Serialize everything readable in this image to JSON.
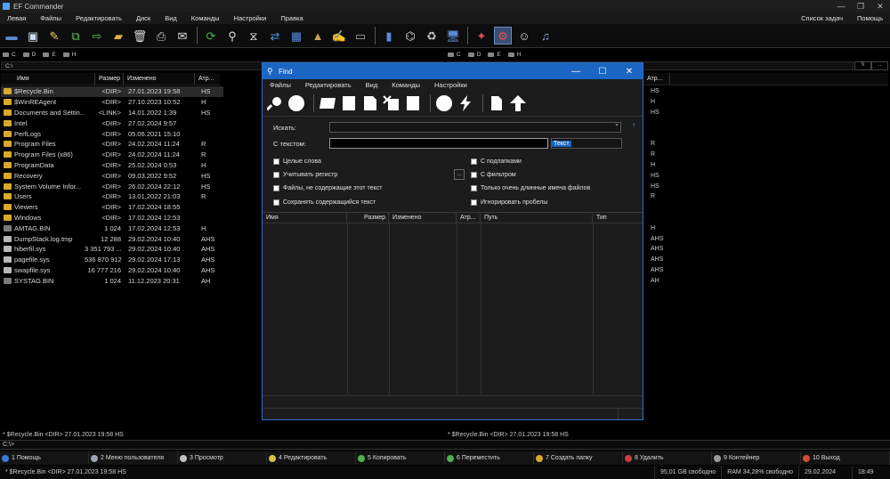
{
  "window": {
    "title": "EF Commander"
  },
  "menu": {
    "left": [
      "Левая",
      "Файлы",
      "Редактировать",
      "Диск",
      "Вид",
      "Команды",
      "Настройки",
      "Правка"
    ],
    "right": [
      "Список задач",
      "Помощь"
    ]
  },
  "drives": {
    "left": [
      "C",
      "D",
      "E",
      "H"
    ],
    "right": [
      "C",
      "D",
      "E",
      "H"
    ]
  },
  "left_path": "C:\\",
  "columns": {
    "name": "Имя",
    "size": "Размер",
    "modified": "Изменено",
    "attr": "Атр..."
  },
  "right_header": {
    "attr": "Атр..."
  },
  "files": [
    {
      "name": "$Recycle.Bin",
      "size": "<DIR>",
      "date": "27.01.2023",
      "time": "19:58",
      "attr": "HS",
      "kind": "folder",
      "selected": true
    },
    {
      "name": "$WinREAgent",
      "size": "<DIR>",
      "date": "27.10.2023",
      "time": "10:52",
      "attr": "H",
      "kind": "folder"
    },
    {
      "name": "Documents and Settin...",
      "size": "<LINK>",
      "date": "14.01.2022",
      "time": "1:39",
      "attr": "HS",
      "kind": "folder"
    },
    {
      "name": "Intel",
      "size": "<DIR>",
      "date": "27.02.2024",
      "time": "9:57",
      "attr": "",
      "kind": "folder"
    },
    {
      "name": "PerfLogs",
      "size": "<DIR>",
      "date": "05.06.2021",
      "time": "15:10",
      "attr": "",
      "kind": "folder"
    },
    {
      "name": "Program Files",
      "size": "<DIR>",
      "date": "24.02.2024",
      "time": "11:24",
      "attr": "R",
      "kind": "folder"
    },
    {
      "name": "Program Files (x86)",
      "size": "<DIR>",
      "date": "24.02.2024",
      "time": "11:24",
      "attr": "R",
      "kind": "folder"
    },
    {
      "name": "ProgramData",
      "size": "<DIR>",
      "date": "25.02.2024",
      "time": "0:53",
      "attr": "H",
      "kind": "folder"
    },
    {
      "name": "Recovery",
      "size": "<DIR>",
      "date": "09.03.2022",
      "time": "9:52",
      "attr": "HS",
      "kind": "folder"
    },
    {
      "name": "System Volume Infor...",
      "size": "<DIR>",
      "date": "26.02.2024",
      "time": "22:12",
      "attr": "HS",
      "kind": "folder"
    },
    {
      "name": "Users",
      "size": "<DIR>",
      "date": "13.01.2022",
      "time": "21:03",
      "attr": "R",
      "kind": "folder"
    },
    {
      "name": "Viewers",
      "size": "<DIR>",
      "date": "17.02.2024",
      "time": "18:55",
      "attr": "",
      "kind": "folder"
    },
    {
      "name": "Windows",
      "size": "<DIR>",
      "date": "17.02.2024",
      "time": "12:53",
      "attr": "",
      "kind": "folder"
    },
    {
      "name": "AMTAG.BIN",
      "size": "1 024",
      "date": "17.02.2024",
      "time": "12:53",
      "attr": "H",
      "kind": "sys"
    },
    {
      "name": "DumpStack.log.tmp",
      "size": "12 288",
      "date": "29.02.2024",
      "time": "10:40",
      "attr": "AHS",
      "kind": "file"
    },
    {
      "name": "hiberfil.sys",
      "size": "3 351 793 ...",
      "date": "29.02.2024",
      "time": "10:40",
      "attr": "AHS",
      "kind": "file"
    },
    {
      "name": "pagefile.sys",
      "size": "536 870 912",
      "date": "29.02.2024",
      "time": "17:13",
      "attr": "AHS",
      "kind": "file"
    },
    {
      "name": "swapfile.sys",
      "size": "16 777 216",
      "date": "29.02.2024",
      "time": "10:40",
      "attr": "AHS",
      "kind": "file"
    },
    {
      "name": "SYSTAG.BIN",
      "size": "1 024",
      "date": "11.12.2023",
      "time": "20:31",
      "attr": "AH",
      "kind": "sys"
    }
  ],
  "right_attrs": [
    "HS",
    "H",
    "HS",
    "",
    "",
    "R",
    "R",
    "H",
    "HS",
    "HS",
    "R",
    "",
    "",
    "H",
    "AHS",
    "AHS",
    "AHS",
    "AHS",
    "AH"
  ],
  "status_left": "* $Recycle.Bin   <DIR>  27.01.2023  19:58  HS",
  "status_right": "* $Recycle.Bin   <DIR>  27.01.2023  19:58  HS",
  "cmdline": "C:\\>",
  "fkeys": [
    {
      "label": "1 Помощь",
      "color": "#3d7bd6"
    },
    {
      "label": "2 Меню пользователя",
      "color": "#9aa4b0"
    },
    {
      "label": "3 Просмотр",
      "color": "#c0c0c0"
    },
    {
      "label": "4 Редактировать",
      "color": "#d8c04a"
    },
    {
      "label": "5 Копировать",
      "color": "#4fb04f"
    },
    {
      "label": "6 Переместить",
      "color": "#4fb04f"
    },
    {
      "label": "7 Создать папку",
      "color": "#d9a92c"
    },
    {
      "label": "8 Удалить",
      "color": "#c94040"
    },
    {
      "label": "9 Контейнер",
      "color": "#9a9a9a"
    },
    {
      "label": "10 Выход",
      "color": "#d04a3a"
    }
  ],
  "bottom": {
    "info": "* $Recycle.Bin   <DIR>  27.01.2023  19:58  HS",
    "free": "95,01 GB свободно",
    "ram": "RAM 34,28% свободно",
    "date": "29.02.2024",
    "time": "18:49"
  },
  "find": {
    "title": "Find",
    "menu": [
      "Файлы",
      "Редактировать",
      "Вид",
      "Команды",
      "Настройки"
    ],
    "search_label": "Искать:",
    "search_value": "",
    "text_label": "С текстом:",
    "text_value": "",
    "text_mode": "Текст",
    "checks_left": [
      "Целые слова",
      "Учитывать регистр",
      "Файлы, не содержащие этот текст",
      "Сохранять содержащийся текст"
    ],
    "checks_right": [
      "С подпапками",
      "С фильтром",
      "Только очень длинные имена файлов",
      "Игнорировать пробелы"
    ],
    "ellipsis": "...",
    "columns": [
      "Имя",
      "Размер",
      "Изменено",
      "Атр...",
      "Путь",
      "Тип"
    ]
  }
}
